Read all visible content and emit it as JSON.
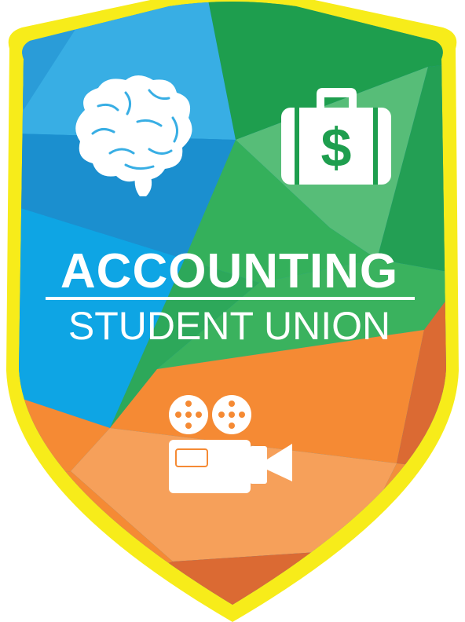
{
  "badge": {
    "title": "ACCOUNTING",
    "subtitle": "STUDENT UNION",
    "currency_symbol": "$",
    "icons": [
      "brain-icon",
      "money-briefcase-icon",
      "video-camera-icon"
    ]
  },
  "colors": {
    "border": "#F7EC1A",
    "blue": "#1B8FCF",
    "light_blue": "#38AEE4",
    "green": "#1E9E4E",
    "mid_green": "#34B05B",
    "pale_green": "#57BD78",
    "orange": "#F58A34",
    "light_orange": "#F6A05A",
    "dark_orange": "#DB6A33",
    "white": "#FFFFFF"
  }
}
